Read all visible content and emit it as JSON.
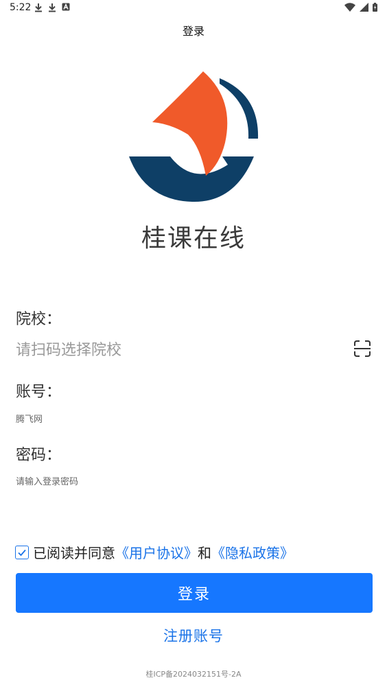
{
  "status_bar": {
    "time": "5:22",
    "left_icons": [
      "download-icon",
      "download-icon",
      "a-icon"
    ],
    "right_icons": [
      "wifi-icon",
      "signal-icon",
      "battery-icon"
    ]
  },
  "header": {
    "title": "登录"
  },
  "brand": {
    "app_name": "桂课在线",
    "logo_colors": {
      "sail": "#F05A2A",
      "hull": "#0E3F66"
    }
  },
  "form": {
    "school": {
      "label": "院校：",
      "placeholder": "请扫码选择院校",
      "scan_icon": "scan-icon"
    },
    "account": {
      "label": "账号：",
      "value": "腾飞网"
    },
    "password": {
      "label": "密码：",
      "placeholder": "请输入登录密码"
    }
  },
  "agreement": {
    "checked": true,
    "prefix": "已阅读并同意",
    "user_agreement": "《用户协议》",
    "and": "和",
    "privacy_policy": "《隐私政策》"
  },
  "actions": {
    "login_label": "登录",
    "register_label": "注册账号"
  },
  "footer": {
    "icp": "桂ICP备2024032151号-2A"
  },
  "colors": {
    "primary": "#1677FF",
    "link": "#1A73E8"
  }
}
